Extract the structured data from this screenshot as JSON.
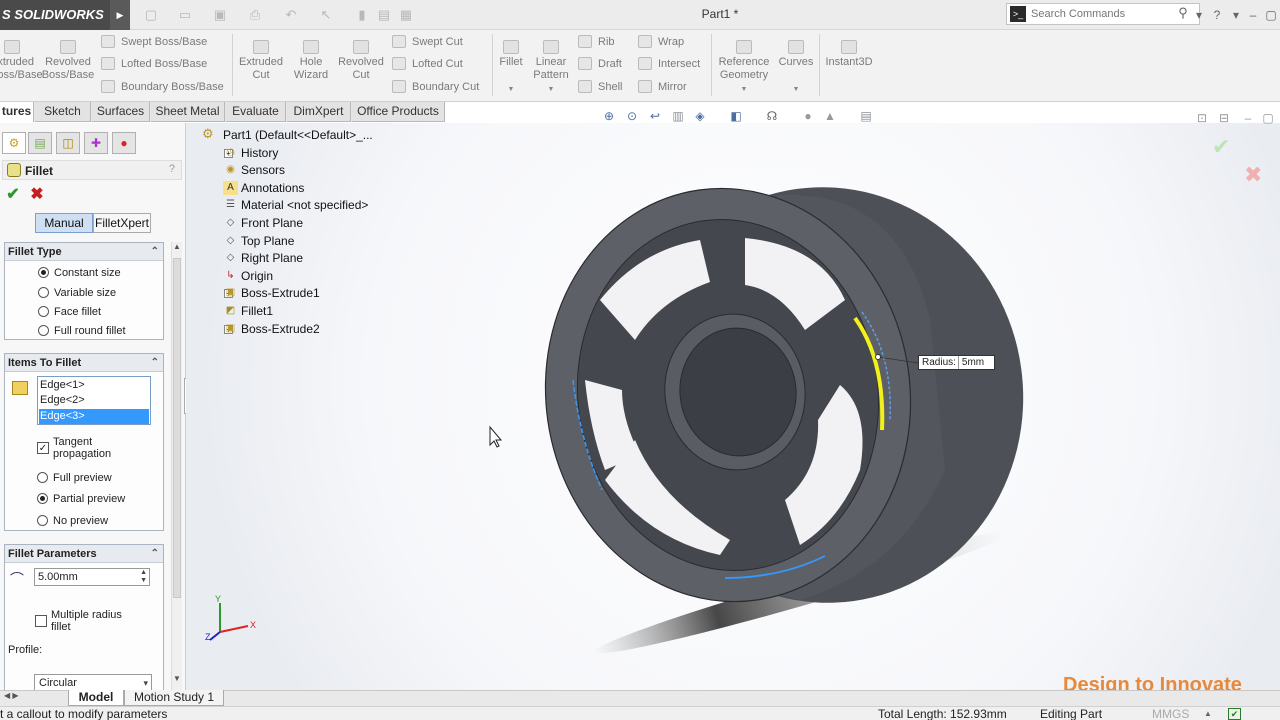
{
  "app": {
    "logo": "S SOLIDWORKS",
    "doc_title": "Part1 *"
  },
  "search": {
    "placeholder": "Search Commands"
  },
  "commands": {
    "extruded_boss": "Extruded\nBoss/Base",
    "revolved_boss": "Revolved\nBoss/Base",
    "swept_boss": "Swept Boss/Base",
    "lofted_boss": "Lofted Boss/Base",
    "boundary_boss": "Boundary Boss/Base",
    "extruded_cut": "Extruded\nCut",
    "hole_wizard": "Hole\nWizard",
    "revolved_cut": "Revolved\nCut",
    "swept_cut": "Swept Cut",
    "lofted_cut": "Lofted Cut",
    "boundary_cut": "Boundary Cut",
    "fillet": "Fillet",
    "linear_pattern": "Linear\nPattern",
    "rib": "Rib",
    "draft": "Draft",
    "shell": "Shell",
    "wrap": "Wrap",
    "intersect": "Intersect",
    "mirror": "Mirror",
    "reference_geometry": "Reference\nGeometry",
    "curves": "Curves",
    "instant3d": "Instant3D"
  },
  "tabs": [
    "tures",
    "Sketch",
    "Surfaces",
    "Sheet Metal",
    "Evaluate",
    "DimXpert",
    "Office Products"
  ],
  "property_manager": {
    "title": "Fillet",
    "help": "?",
    "mode_tabs": [
      "Manual",
      "FilletXpert"
    ],
    "fillet_type": {
      "header": "Fillet Type",
      "options": [
        "Constant size",
        "Variable size",
        "Face fillet",
        "Full round fillet"
      ],
      "selected": "Constant size"
    },
    "items": {
      "header": "Items To Fillet",
      "edges": [
        "Edge<1>",
        "Edge<2>",
        "Edge<3>"
      ],
      "selected_edge": "Edge<3>",
      "tangent_propagation": "Tangent\npropagation",
      "tangent_checked": true,
      "preview_options": [
        "Full preview",
        "Partial preview",
        "No preview"
      ],
      "preview_selected": "Partial preview"
    },
    "parameters": {
      "header": "Fillet Parameters",
      "radius": "5.00mm",
      "multiple_radius": "Multiple radius\nfillet",
      "multiple_checked": false,
      "profile_label": "Profile:",
      "profile_value": "Circular"
    }
  },
  "tree": {
    "root": "Part1  (Default<<Default>_...",
    "items": [
      "History",
      "Sensors",
      "Annotations",
      "Material <not specified>",
      "Front Plane",
      "Top Plane",
      "Right Plane",
      "Origin",
      "Boss-Extrude1",
      "Fillet1",
      "Boss-Extrude2"
    ]
  },
  "callout": {
    "label": "Radius:",
    "value": "5mm"
  },
  "triad": {
    "x": "X",
    "y": "Y",
    "z": "Z"
  },
  "bottom_tabs": [
    "Model",
    "Motion Study 1"
  ],
  "status": {
    "message": "t a callout to modify parameters",
    "total_length": "Total Length: 152.93mm",
    "mode": "Editing Part",
    "units": "MMGS"
  },
  "brand": "Design to Innovate",
  "colors": {
    "selection_blue": "#3399ff",
    "preview_yellow": "#f2f21a",
    "brand_orange": "#e8883a",
    "part_gray": "#5c5e66"
  }
}
